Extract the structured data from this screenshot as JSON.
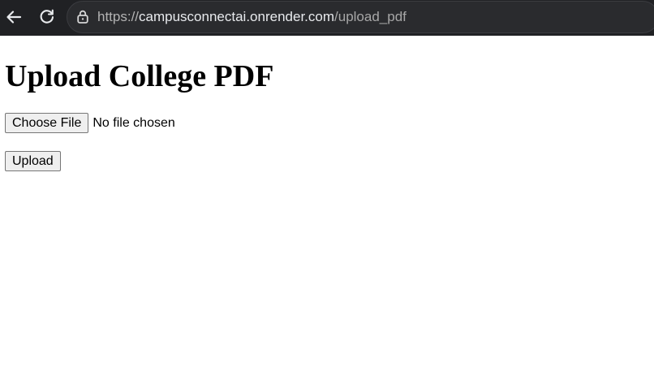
{
  "browser": {
    "url": {
      "scheme": "https://",
      "host": "campusconnectai.onrender.com",
      "path": "/upload_pdf"
    },
    "icons": {
      "back": "back-arrow-icon",
      "reload": "reload-icon",
      "site_info": "lock-icon"
    }
  },
  "page": {
    "title": "Upload College PDF",
    "file_input": {
      "button_label": "Choose File",
      "status": "No file chosen"
    },
    "upload_button_label": "Upload"
  },
  "colors": {
    "browser_background": "#202124",
    "address_bar": "#2a2b2e",
    "page_background": "#ffffff",
    "button_background": "#efefef"
  }
}
